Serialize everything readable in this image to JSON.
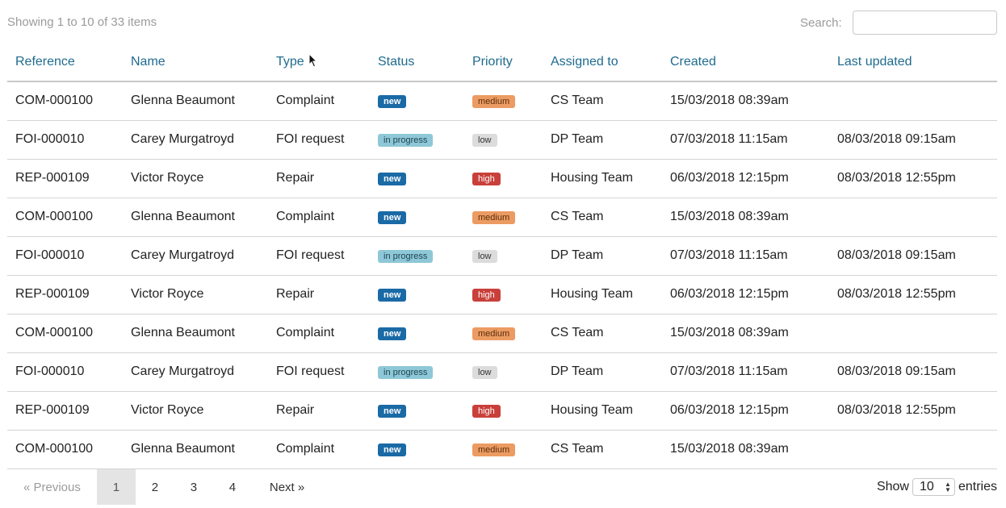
{
  "info_text": "Showing 1 to 10 of 33 items",
  "search": {
    "label": "Search:",
    "value": ""
  },
  "columns": [
    "Reference",
    "Name",
    "Type",
    "Status",
    "Priority",
    "Assigned to",
    "Created",
    "Last updated"
  ],
  "rows": [
    {
      "reference": "COM-000100",
      "name": "Glenna Beaumont",
      "type": "Complaint",
      "status": "new",
      "priority": "medium",
      "assigned": "CS Team",
      "created": "15/03/2018 08:39am",
      "updated": ""
    },
    {
      "reference": "FOI-000010",
      "name": "Carey Murgatroyd",
      "type": "FOI request",
      "status": "in progress",
      "priority": "low",
      "assigned": "DP Team",
      "created": "07/03/2018 11:15am",
      "updated": "08/03/2018 09:15am"
    },
    {
      "reference": "REP-000109",
      "name": "Victor Royce",
      "type": "Repair",
      "status": "new",
      "priority": "high",
      "assigned": "Housing Team",
      "created": "06/03/2018 12:15pm",
      "updated": "08/03/2018 12:55pm"
    },
    {
      "reference": "COM-000100",
      "name": "Glenna Beaumont",
      "type": "Complaint",
      "status": "new",
      "priority": "medium",
      "assigned": "CS Team",
      "created": "15/03/2018 08:39am",
      "updated": ""
    },
    {
      "reference": "FOI-000010",
      "name": "Carey Murgatroyd",
      "type": "FOI request",
      "status": "in progress",
      "priority": "low",
      "assigned": "DP Team",
      "created": "07/03/2018 11:15am",
      "updated": "08/03/2018 09:15am"
    },
    {
      "reference": "REP-000109",
      "name": "Victor Royce",
      "type": "Repair",
      "status": "new",
      "priority": "high",
      "assigned": "Housing Team",
      "created": "06/03/2018 12:15pm",
      "updated": "08/03/2018 12:55pm"
    },
    {
      "reference": "COM-000100",
      "name": "Glenna Beaumont",
      "type": "Complaint",
      "status": "new",
      "priority": "medium",
      "assigned": "CS Team",
      "created": "15/03/2018 08:39am",
      "updated": ""
    },
    {
      "reference": "FOI-000010",
      "name": "Carey Murgatroyd",
      "type": "FOI request",
      "status": "in progress",
      "priority": "low",
      "assigned": "DP Team",
      "created": "07/03/2018 11:15am",
      "updated": "08/03/2018 09:15am"
    },
    {
      "reference": "REP-000109",
      "name": "Victor Royce",
      "type": "Repair",
      "status": "new",
      "priority": "high",
      "assigned": "Housing Team",
      "created": "06/03/2018 12:15pm",
      "updated": "08/03/2018 12:55pm"
    },
    {
      "reference": "COM-000100",
      "name": "Glenna Beaumont",
      "type": "Complaint",
      "status": "new",
      "priority": "medium",
      "assigned": "CS Team",
      "created": "15/03/2018 08:39am",
      "updated": ""
    }
  ],
  "pagination": {
    "previous": "« Previous",
    "next": "Next »",
    "pages": [
      "1",
      "2",
      "3",
      "4"
    ],
    "active": "1"
  },
  "length": {
    "show_label": "Show",
    "value": "10",
    "entries_label": "entries"
  },
  "colors": {
    "header_link": "#1f6b8e",
    "status_new": "#1a6aa6",
    "status_in_progress": "#8ec8d8",
    "priority_medium": "#ec9b62",
    "priority_low": "#dcdcdc",
    "priority_high": "#c9403a"
  }
}
